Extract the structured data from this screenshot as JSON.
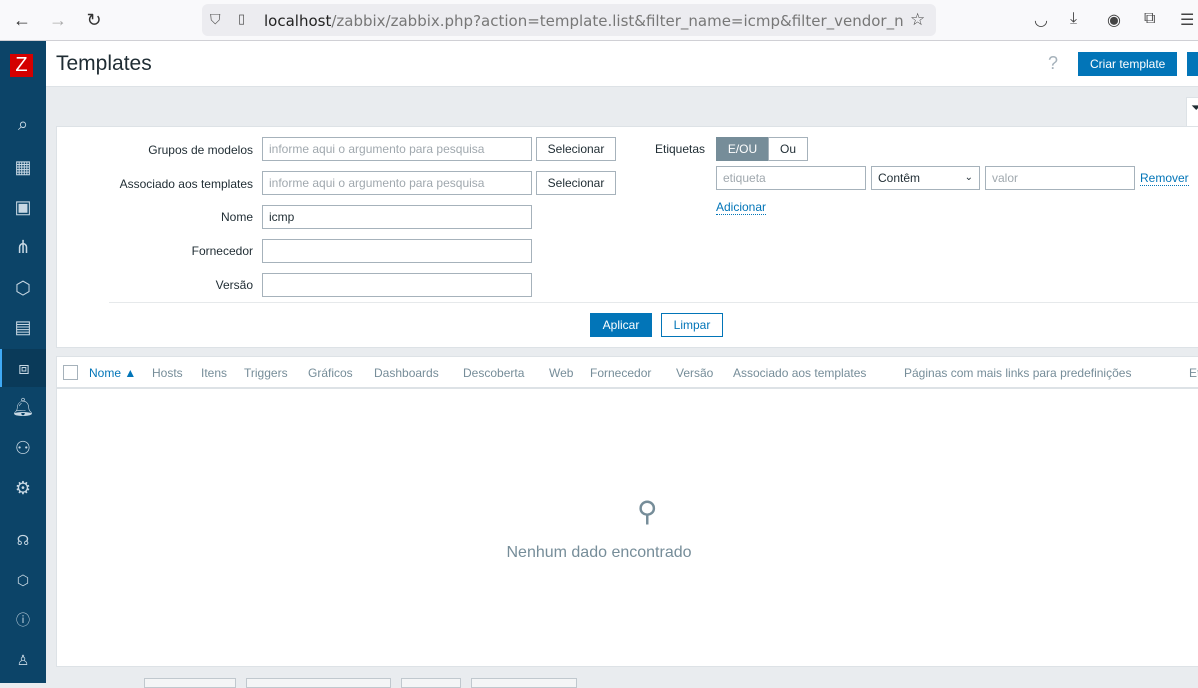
{
  "browser": {
    "url_host": "localhost",
    "url_rest": "/zabbix/zabbix.php?action=template.list&filter_name=icmp&filter_vendor_name=&f"
  },
  "sidebar": {
    "logo": "Z",
    "items": [
      "search-icon",
      "dashboard-icon",
      "monitoring-icon",
      "services-icon",
      "inventory-icon",
      "reports-icon",
      "data-collection-icon",
      "alerts-icon",
      "users-icon",
      "administration-icon",
      "support-icon",
      "integrations-icon",
      "help-icon",
      "user-settings-icon"
    ]
  },
  "header": {
    "title": "Templates",
    "help": "?",
    "create_button": "Criar template"
  },
  "filter": {
    "groups_label": "Grupos de modelos",
    "groups_placeholder": "informe aqui o argumento para pesquisa",
    "select1": "Selecionar",
    "linked_label": "Associado aos templates",
    "linked_placeholder": "informe aqui o argumento para pesquisa",
    "select2": "Selecionar",
    "name_label": "Nome",
    "name_value": "icmp",
    "vendor_label": "Fornecedor",
    "vendor_value": "",
    "version_label": "Versão",
    "version_value": "",
    "tags_label": "Etiquetas",
    "and_or": "E/OU",
    "or": "Ou",
    "tag_placeholder": "etiqueta",
    "operator": "Contêm",
    "value_placeholder": "valor",
    "remove": "Remover",
    "add": "Adicionar",
    "apply": "Aplicar",
    "reset": "Limpar"
  },
  "table": {
    "columns": [
      "Nome ▲",
      "Hosts",
      "Itens",
      "Triggers",
      "Gráficos",
      "Dashboards",
      "Descoberta",
      "Web",
      "Fornecedor",
      "Versão",
      "Associado aos templates",
      "Páginas com mais links para predefinições",
      "Et"
    ],
    "empty": "Nenhum dado encontrado"
  }
}
